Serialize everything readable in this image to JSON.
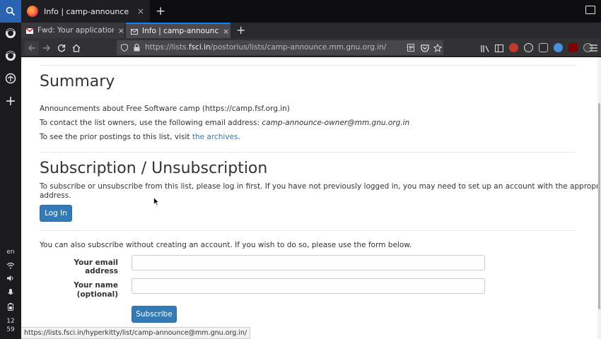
{
  "os": {
    "language": "en",
    "clock_hour": "12",
    "clock_minute": "59",
    "top_tab_title": "Info | camp-announce@...",
    "top_tab_close": "×",
    "top_new_tab": "+",
    "icons": [
      "search-icon",
      "firefox-icon",
      "firefox-icon",
      "update-icon",
      "plus-icon",
      "wifi-icon",
      "volume-icon",
      "mic-icon",
      "battery-icon"
    ]
  },
  "browser": {
    "tabs": [
      {
        "title": "Fwd: Your application fo",
        "favicon": "gmail-icon",
        "close": "×",
        "active": false
      },
      {
        "title": "Info | camp-announce@m",
        "favicon": "mail-icon",
        "close": "×",
        "active": true
      }
    ],
    "new_tab": "+",
    "url_prefix": "https://lists.",
    "url_domain": "fsci.in",
    "url_path": "/postorius/lists/camp-announce.mm.gnu.org.in/",
    "page_actions": "···"
  },
  "page": {
    "summary": {
      "heading": "Summary",
      "description": "Announcements about Free Software camp (https://camp.fsf.org.in)",
      "contact_prefix": "To contact the list owners, use the following email address: ",
      "contact_email": "camp-announce-owner@mm.gnu.org.in",
      "archives_prefix": "To see the prior postings to this list, visit ",
      "archives_link": "the archives",
      "archives_suffix": "."
    },
    "subscription": {
      "heading": "Subscription / Unsubscription",
      "instructions_line1": "To subscribe or unsubscribe from this list, please log in first. If you have not previously logged in, you may need to set up an account with the appropriate email",
      "instructions_line2": "address.",
      "login_button": "Log In",
      "alt_text": "You can also subscribe without creating an account. If you wish to do so, please use the form below.",
      "email_label": "Your email address",
      "email_value": "",
      "name_label_line1": "Your name",
      "name_label_line2": "(optional)",
      "name_value": "",
      "subscribe_button": "Subscribe"
    }
  },
  "status_url": "https://lists.fsci.in/hyperkitty/list/camp-announce@mm.gnu.org.in/",
  "colors": {
    "link": "#337ab7",
    "button": "#337ab7",
    "active_tab_accent": "#0a84ff",
    "os_accent": "#2b63b3"
  }
}
